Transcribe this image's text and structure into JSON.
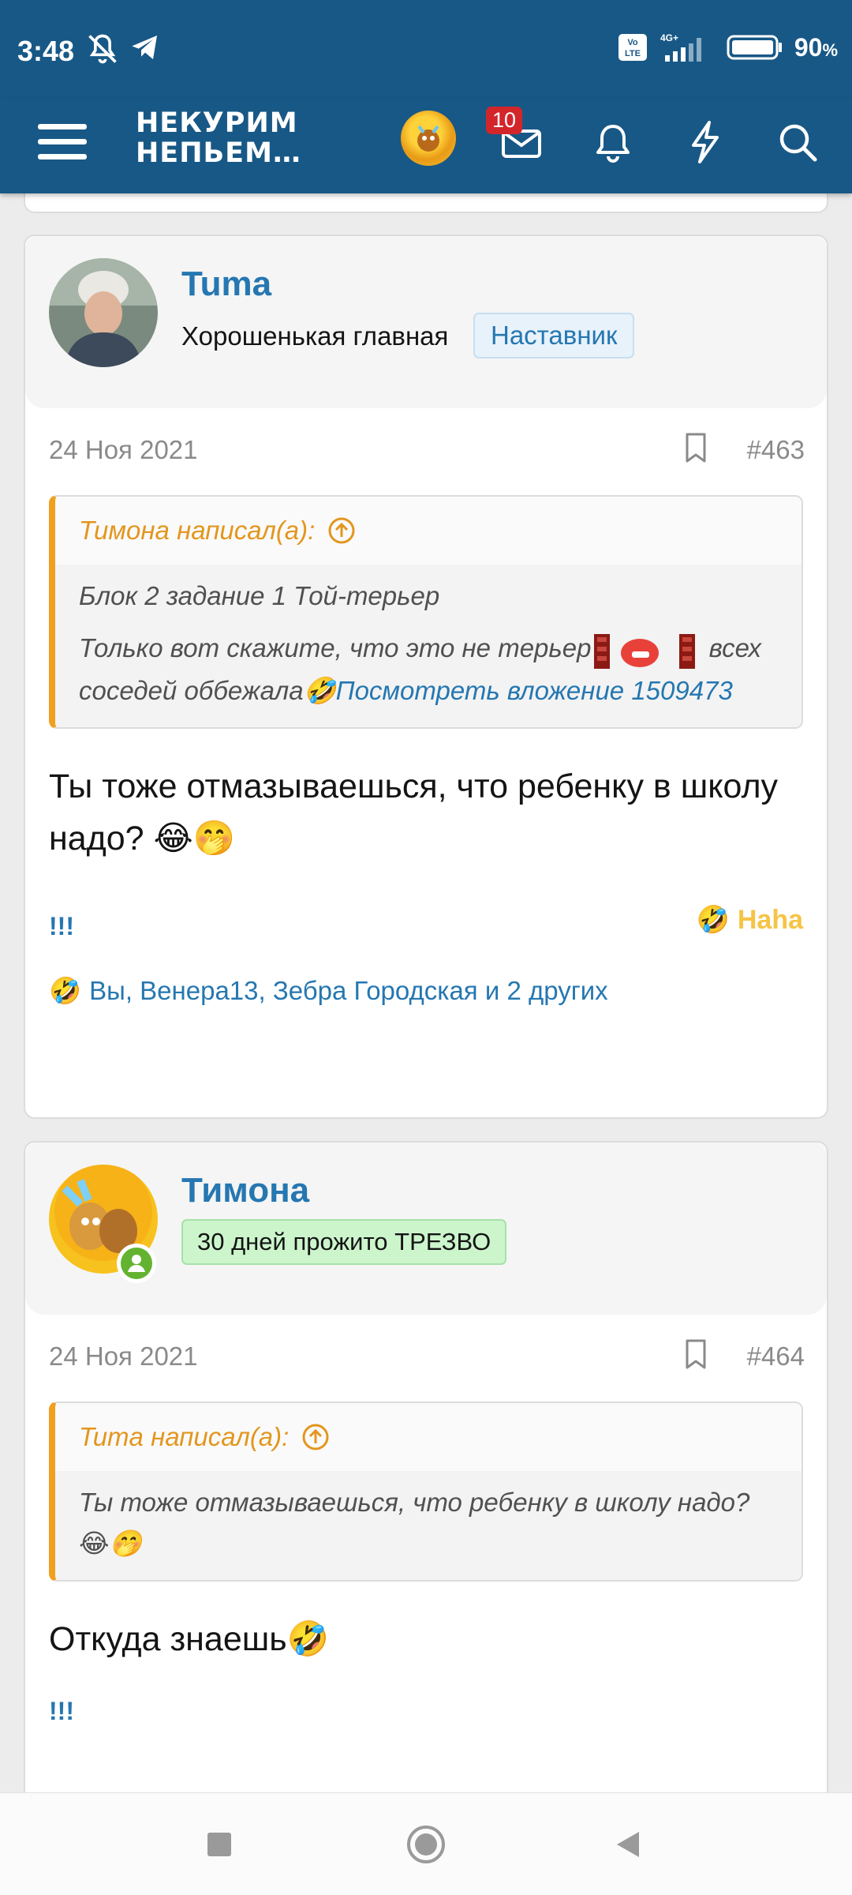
{
  "status_bar": {
    "time": "3:48",
    "network": "4G+",
    "volte": "Vo LTE",
    "battery_percent": "90",
    "battery_unit": "%"
  },
  "header": {
    "logo_line1": "НЕКУРИМ",
    "logo_line2": "НЕПЬЕМ…",
    "messages_badge": "10",
    "icons": [
      "menu-icon",
      "avatar",
      "mail-icon",
      "bell-icon",
      "lightning-icon",
      "search-icon"
    ]
  },
  "posts": [
    {
      "username": "Tuma",
      "user_title": "Хорошенькая главная",
      "role_badge": "Наставник",
      "date": "24 Ноя 2021",
      "number": "#463",
      "quote": {
        "author_line": "Тимона написал(а):",
        "lines": [
          "Блок 2 задание 1 Той-терьер",
          "Только вот скажите, что это не терьер"
        ],
        "line2_tail": "всех соседей оббежала",
        "link": "Посмотреть вложение 1509473"
      },
      "text": "Ты тоже отмазываешься, что ребенку в школу надо?",
      "text_emoji": "😂🤭",
      "action_left": "!!!",
      "reaction_label": "Haha",
      "reactions_text": "Вы, Венера13, Зебра Городская и 2 других"
    },
    {
      "username": "Тимона",
      "badge": "30 дней прожито ТРЕЗВО",
      "date": "24 Ноя 2021",
      "number": "#464",
      "quote": {
        "author_line": "Tuma написал(а):",
        "text": "Ты тоже отмазываешься, что ребенку в школу надо?",
        "text_emoji": "😂🤭"
      },
      "text": "Откуда знаешь",
      "text_emoji": "🤣",
      "action_left": "!!!"
    }
  ],
  "colors": {
    "header_bg": "#185886",
    "link": "#2577b1",
    "quote_accent": "#f0a01f",
    "haha": "#f6c445",
    "badge_red": "#d3262b"
  }
}
